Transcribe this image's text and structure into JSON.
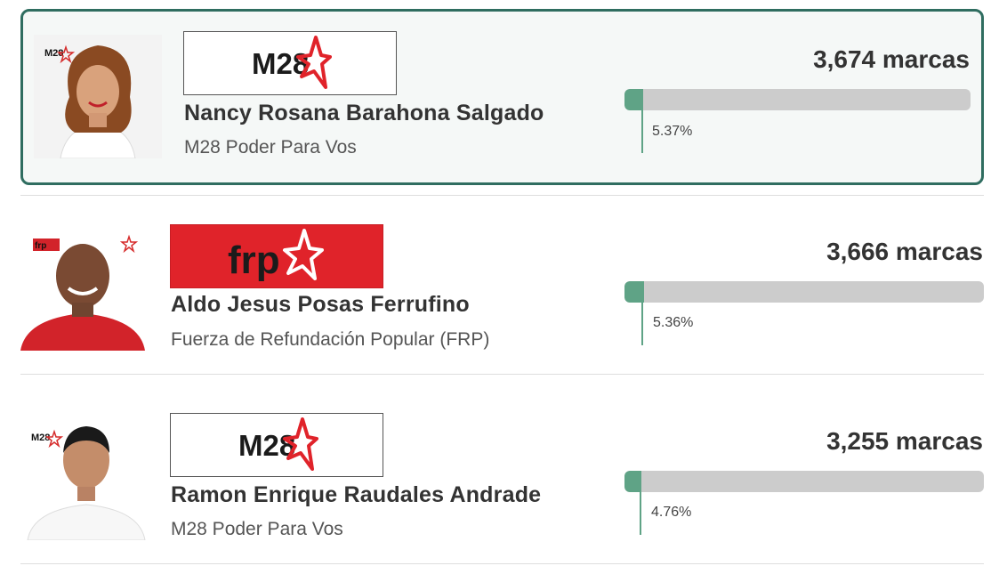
{
  "accent_color": "#5fa386",
  "selected_border_color": "#2f6d60",
  "candidates": [
    {
      "name": "Nancy Rosana Barahona Salgado",
      "party": "M28 Poder Para Vos",
      "party_logo": "M28",
      "photo_badge": "M28",
      "votes": "3,674 marcas",
      "percent_label": "5.37%",
      "percent": 5.37,
      "selected": true
    },
    {
      "name": "Aldo Jesus Posas Ferrufino",
      "party": "Fuerza de Refundación Popular (FRP)",
      "party_logo": "frp",
      "photo_badge": "frp",
      "votes": "3,666 marcas",
      "percent_label": "5.36%",
      "percent": 5.36,
      "selected": false
    },
    {
      "name": "Ramon Enrique Raudales Andrade",
      "party": "M28 Poder Para Vos",
      "party_logo": "M28",
      "photo_badge": "M28",
      "votes": "3,255 marcas",
      "percent_label": "4.76%",
      "percent": 4.76,
      "selected": false
    }
  ]
}
